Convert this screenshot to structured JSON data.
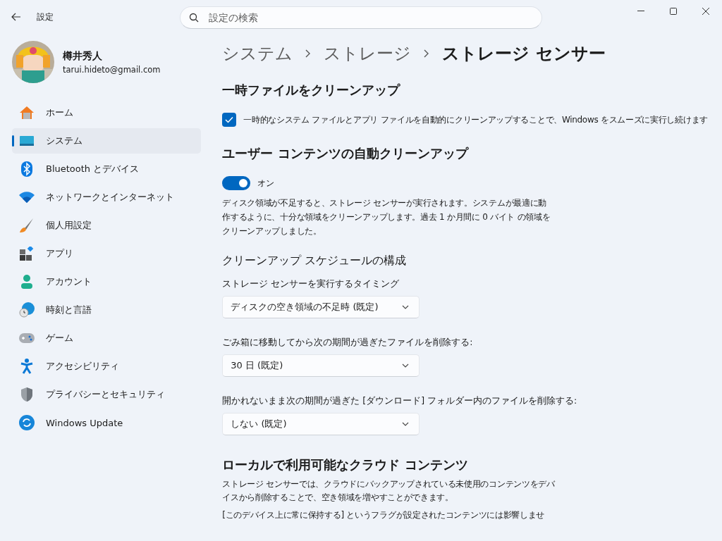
{
  "window": {
    "title": "設定"
  },
  "search": {
    "placeholder": "設定の検索"
  },
  "user": {
    "name": "樽井秀人",
    "email": "tarui.hideto@gmail.com"
  },
  "nav": [
    {
      "label": "ホーム",
      "selected": false
    },
    {
      "label": "システム",
      "selected": true
    },
    {
      "label": "Bluetooth とデバイス",
      "selected": false
    },
    {
      "label": "ネットワークとインターネット",
      "selected": false
    },
    {
      "label": "個人用設定",
      "selected": false
    },
    {
      "label": "アプリ",
      "selected": false
    },
    {
      "label": "アカウント",
      "selected": false
    },
    {
      "label": "時刻と言語",
      "selected": false
    },
    {
      "label": "ゲーム",
      "selected": false
    },
    {
      "label": "アクセシビリティ",
      "selected": false
    },
    {
      "label": "プライバシーとセキュリティ",
      "selected": false
    },
    {
      "label": "Windows Update",
      "selected": false
    }
  ],
  "breadcrumb": [
    "システム",
    "ストレージ",
    "ストレージ センサー"
  ],
  "temp_cleanup": {
    "heading": "一時ファイルをクリーンアップ",
    "checkbox": {
      "label": "一時的なシステム ファイルとアプリ ファイルを自動的にクリーンアップすることで、Windows をスムーズに実行し続けます",
      "checked": true
    }
  },
  "user_content": {
    "heading": "ユーザー コンテンツの自動クリーンアップ",
    "toggle": {
      "on": true,
      "label": "オン"
    },
    "description": "ディスク領域が不足すると、ストレージ センサーが実行されます。システムが最適に動作するように、十分な領域をクリーンアップします。過去 1 か月間に 0 バイト の領域をクリーンアップしました。"
  },
  "schedule": {
    "heading": "クリーンアップ スケジュールの構成",
    "dropdowns": [
      {
        "label": "ストレージ センサーを実行するタイミング",
        "value": "ディスクの空き領域の不足時 (既定)"
      },
      {
        "label": "ごみ箱に移動してから次の期間が過ぎたファイルを削除する:",
        "value": "30 日 (既定)"
      },
      {
        "label": "開かれないまま次の期間が過ぎた [ダウンロード] フォルダー内のファイルを削除する:",
        "value": "しない (既定)"
      }
    ]
  },
  "cloud": {
    "heading": "ローカルで利用可能なクラウド コンテンツ",
    "paragraphs": [
      "ストレージ センサーでは、クラウドにバックアップされている未使用のコンテンツをデバイスから削除することで、空き領域を増やすことができます。",
      "[このデバイス上に常に保持する] というフラグが設定されたコンテンツには影響しませ"
    ]
  }
}
